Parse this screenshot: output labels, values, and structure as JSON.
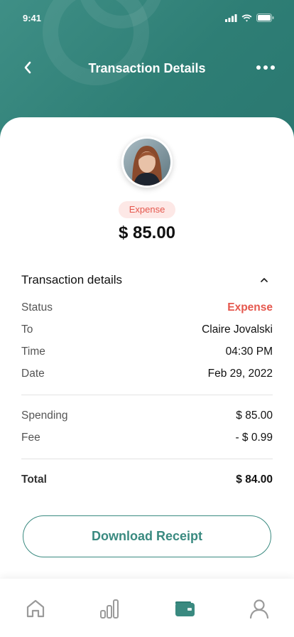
{
  "status_bar": {
    "time": "9:41"
  },
  "header": {
    "title": "Transaction Details"
  },
  "transaction": {
    "type": "Expense",
    "amount": "$ 85.00"
  },
  "details": {
    "title": "Transaction details",
    "status_label": "Status",
    "status_value": "Expense",
    "to_label": "To",
    "to_value": "Claire Jovalski",
    "time_label": "Time",
    "time_value": "04:30 PM",
    "date_label": "Date",
    "date_value": "Feb 29, 2022",
    "spending_label": "Spending",
    "spending_value": "$ 85.00",
    "fee_label": "Fee",
    "fee_value": "- $ 0.99",
    "total_label": "Total",
    "total_value": "$ 84.00"
  },
  "actions": {
    "download_label": "Download Receipt"
  },
  "bottom_nav": {
    "items": [
      "home-icon",
      "stats-icon",
      "wallet-icon",
      "profile-icon"
    ],
    "active": "wallet-icon"
  },
  "colors": {
    "primary": "#3a8a80",
    "expense": "#e5574d",
    "expense_bg": "#fde8e6",
    "inactive": "#9a9a9a"
  }
}
